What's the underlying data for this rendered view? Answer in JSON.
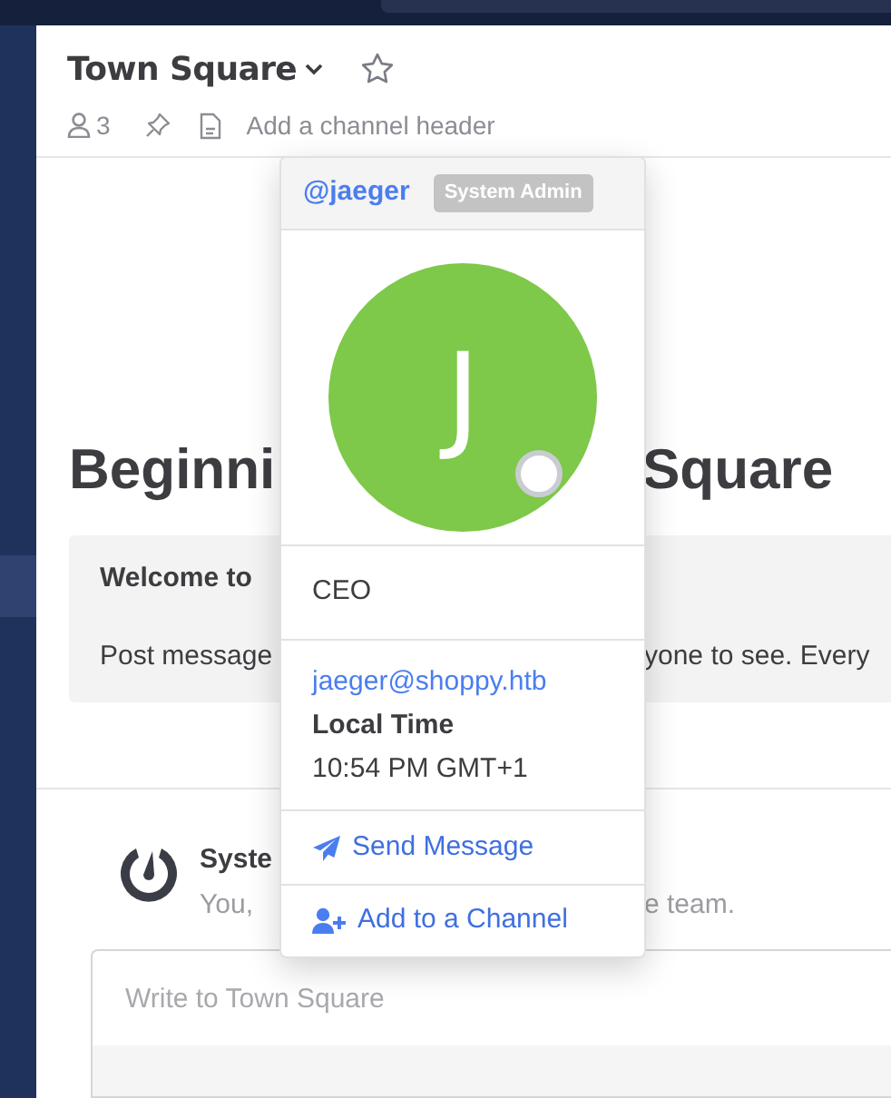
{
  "channel": {
    "name": "Town Square",
    "favorite": false,
    "member_count": "3",
    "header_placeholder": "Add a channel header"
  },
  "intro": {
    "title_left": "Beginni",
    "title_right": "Square",
    "welcome": "Welcome to",
    "post_left": "Post message",
    "post_right": "yone to see. Every"
  },
  "system_post": {
    "author": "Syste",
    "text_left": "You,",
    "text_right": "e team."
  },
  "composer": {
    "placeholder": "Write to Town Square"
  },
  "profile_popover": {
    "username": "@jaeger",
    "role_badge": "System Admin",
    "avatar_initial": "J",
    "online": false,
    "position": "CEO",
    "email": "jaeger@shoppy.htb",
    "local_time_label": "Local Time",
    "local_time": "10:54 PM GMT+1",
    "actions": [
      {
        "kind": "message",
        "label": "Send Message"
      },
      {
        "kind": "add",
        "label": "Add to a Channel"
      }
    ]
  }
}
